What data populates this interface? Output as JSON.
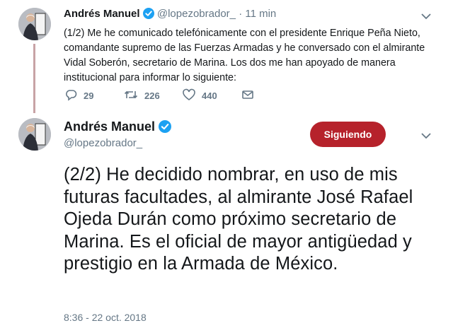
{
  "tweet1": {
    "name": "Andrés Manuel",
    "handle": "@lopezobrador_",
    "separator": "·",
    "time": "11 min",
    "text": "(1/2) Me he comunicado telefónicamente con el presidente Enrique Peña Nieto, comandante supremo de las Fuerzas Armadas y he conversado con el almirante Vidal Soberón, secretario de Marina. Los dos me han apoyado de manera institucional para informar lo siguiente:",
    "replies": "29",
    "retweets": "226",
    "likes": "440"
  },
  "tweet2": {
    "name": "Andrés Manuel",
    "handle": "@lopezobrador_",
    "follow_label": "Siguiendo",
    "text": "(2/2) He decidido nombrar, en uso de mis futuras facultades, al almirante José Rafael Ojeda Durán como próximo secretario de Marina. Es el oficial de mayor antigüedad y prestigio en la Armada de México.",
    "timestamp": "8:36 - 22 oct. 2018"
  },
  "colors": {
    "verified": "#1da1f2",
    "follow_button": "#b6222b",
    "thread_line": "#c8a3a6",
    "muted": "#657786"
  },
  "icons": [
    "verified-badge-icon",
    "chevron-down-icon",
    "reply-icon",
    "retweet-icon",
    "like-icon",
    "direct-message-icon"
  ]
}
